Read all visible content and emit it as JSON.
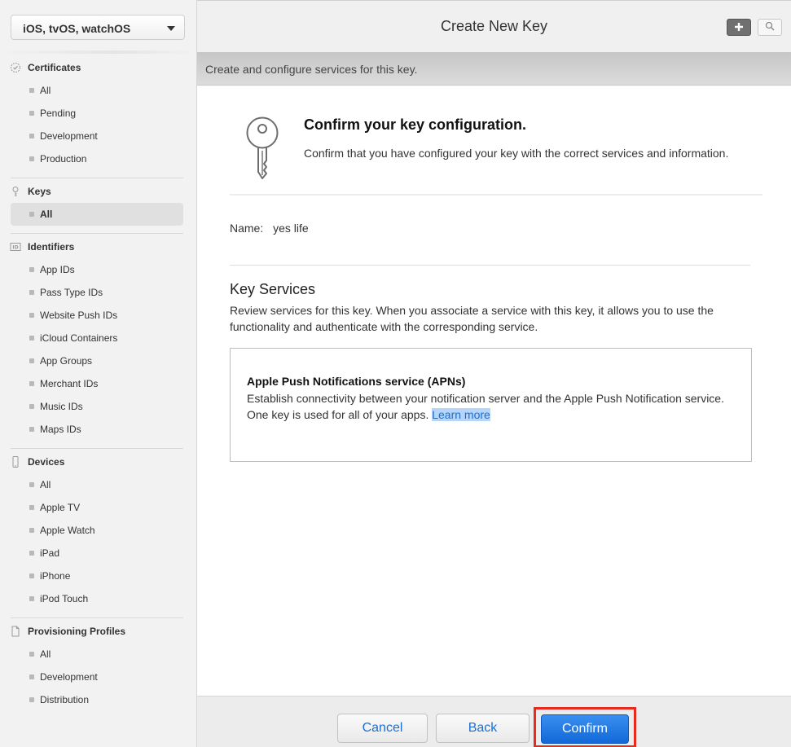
{
  "platform_selector": {
    "value": "iOS, tvOS, watchOS"
  },
  "sidebar": {
    "sections": [
      {
        "title": "Certificates",
        "icon": "certificate-icon",
        "items": [
          "All",
          "Pending",
          "Development",
          "Production"
        ]
      },
      {
        "title": "Keys",
        "icon": "key-icon",
        "items": [
          "All"
        ],
        "active_item": "All"
      },
      {
        "title": "Identifiers",
        "icon": "id-icon",
        "items": [
          "App IDs",
          "Pass Type IDs",
          "Website Push IDs",
          "iCloud Containers",
          "App Groups",
          "Merchant IDs",
          "Music IDs",
          "Maps IDs"
        ]
      },
      {
        "title": "Devices",
        "icon": "device-icon",
        "items": [
          "All",
          "Apple TV",
          "Apple Watch",
          "iPad",
          "iPhone",
          "iPod Touch"
        ]
      },
      {
        "title": "Provisioning Profiles",
        "icon": "document-icon",
        "items": [
          "All",
          "Development",
          "Distribution"
        ]
      }
    ]
  },
  "header": {
    "title": "Create New Key",
    "add_icon": "plus-icon",
    "search_icon": "search-icon",
    "subtitle": "Create and configure services for this key."
  },
  "confirm": {
    "title": "Confirm your key configuration.",
    "description": "Confirm that you have configured your key with the correct services and information.",
    "name_label": "Name:",
    "name_value": "yes life"
  },
  "key_services": {
    "title": "Key Services",
    "description": "Review services for this key. When you associate a service with this key, it allows you to use the functionality and authenticate with the corresponding service.",
    "service": {
      "name": "Apple Push Notifications service (APNs)",
      "description": "Establish connectivity between your notification server and the Apple Push Notification service. One key is used for all of your apps.",
      "link": "Learn more"
    }
  },
  "footer": {
    "cancel_label": "Cancel",
    "back_label": "Back",
    "confirm_label": "Confirm"
  },
  "colors": {
    "accent": "#1b6fd3",
    "confirm_button": "#1268d8",
    "highlight_border": "#e8291c"
  }
}
